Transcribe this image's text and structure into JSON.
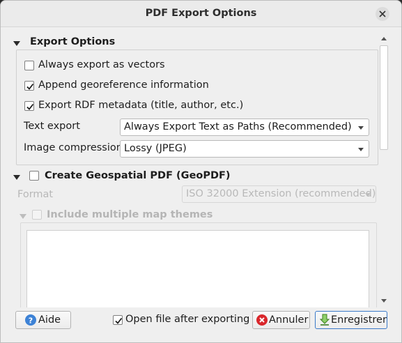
{
  "window": {
    "title": "PDF Export Options"
  },
  "export_options": {
    "title": "Export Options",
    "always_vectors": {
      "label": "Always export as vectors",
      "checked": false
    },
    "append_georef": {
      "label": "Append georeference information",
      "checked": true
    },
    "export_rdf": {
      "label": "Export RDF metadata (title, author, etc.)",
      "checked": true
    },
    "text_export": {
      "label": "Text export",
      "value": "Always Export Text as Paths (Recommended)"
    },
    "image_compression": {
      "label": "Image compression",
      "value": "Lossy (JPEG)"
    }
  },
  "geopdf": {
    "title": "Create Geospatial PDF (GeoPDF)",
    "checked": false,
    "format": {
      "label": "Format",
      "value": "ISO 32000 Extension (recommended)"
    },
    "themes": {
      "label": "Include multiple map themes",
      "checked": false
    }
  },
  "footer": {
    "help_label": "Aide",
    "open_after": {
      "label": "Open file after exporting",
      "checked": true
    },
    "cancel_label": "Annuler",
    "save_label": "Enregistrer"
  },
  "colors": {
    "help_icon": "#3d82d6",
    "cancel_icon": "#d9262b",
    "save_icon": "#5aa13a",
    "default_border": "#3b7ac9"
  },
  "icons": {
    "close": "close-icon",
    "help": "help-icon",
    "cancel": "cancel-icon",
    "save": "save-arrow-icon"
  }
}
